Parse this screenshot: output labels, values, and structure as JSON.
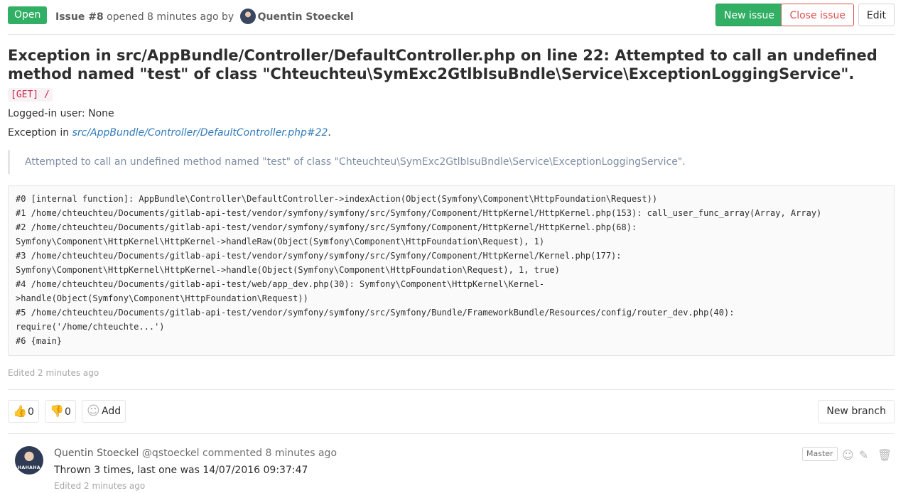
{
  "header": {
    "status": "Open",
    "issue_ref": "Issue #8",
    "opened_text": "opened 8 minutes ago by",
    "author": "Quentin Stoeckel",
    "buttons": {
      "new_issue": "New issue",
      "close_issue": "Close issue",
      "edit": "Edit"
    }
  },
  "issue": {
    "title": "Exception in src/AppBundle/Controller/DefaultController.php on line 22: Attempted to call an undefined method named \"test\" of class \"Chteuchteu\\SymExc2GtlbIsuBndle\\Service\\ExceptionLoggingService\".",
    "request": "[GET] /",
    "logged_in": "Logged-in user: None",
    "exception_prefix": "Exception in",
    "exception_link": "src/AppBundle/Controller/DefaultController.php#22",
    "exception_suffix": ".",
    "quote": "Attempted to call an undefined method named \"test\" of class \"Chteuchteu\\SymExc2GtlbIsuBndle\\Service\\ExceptionLoggingService\".",
    "trace": [
      "#0 [internal function]: AppBundle\\Controller\\DefaultController->indexAction(Object(Symfony\\Component\\HttpFoundation\\Request))",
      "#1 /home/chteuchteu/Documents/gitlab-api-test/vendor/symfony/symfony/src/Symfony/Component/HttpKernel/HttpKernel.php(153): call_user_func_array(Array, Array)",
      "#2 /home/chteuchteu/Documents/gitlab-api-test/vendor/symfony/symfony/src/Symfony/Component/HttpKernel/HttpKernel.php(68):",
      "Symfony\\Component\\HttpKernel\\HttpKernel->handleRaw(Object(Symfony\\Component\\HttpFoundation\\Request), 1)",
      "#3 /home/chteuchteu/Documents/gitlab-api-test/vendor/symfony/symfony/src/Symfony/Component/HttpKernel/Kernel.php(177):",
      "Symfony\\Component\\HttpKernel\\HttpKernel->handle(Object(Symfony\\Component\\HttpFoundation\\Request), 1, true)",
      "#4 /home/chteuchteu/Documents/gitlab-api-test/web/app_dev.php(30): Symfony\\Component\\HttpKernel\\Kernel-",
      ">handle(Object(Symfony\\Component\\HttpFoundation\\Request))",
      "#5 /home/chteuchteu/Documents/gitlab-api-test/vendor/symfony/symfony/src/Symfony/Bundle/FrameworkBundle/Resources/config/router_dev.php(40):",
      "require('/home/chteuchte...')",
      "#6 {main}"
    ],
    "edited": "Edited 2 minutes ago"
  },
  "awards": {
    "thumbs_up_icon": "thumbs-up-icon",
    "thumbs_up_count": "0",
    "thumbs_down_icon": "thumbs-down-icon",
    "thumbs_down_count": "0",
    "add_label": "Add",
    "new_branch": "New branch"
  },
  "note": {
    "author": "Quentin Stoeckel",
    "handle": "@qstoeckel",
    "action": "commented 8 minutes ago",
    "role": "Master",
    "body": "Thrown 3 times, last one was 14/07/2016 09:37:47",
    "edited": "Edited 2 minutes ago",
    "avatar_text": "HAHAHA"
  },
  "colors": {
    "accent_green": "#31af64",
    "danger_red": "#d9534f",
    "link_blue": "#2f7ab9",
    "inline_code": "#c7254e"
  }
}
